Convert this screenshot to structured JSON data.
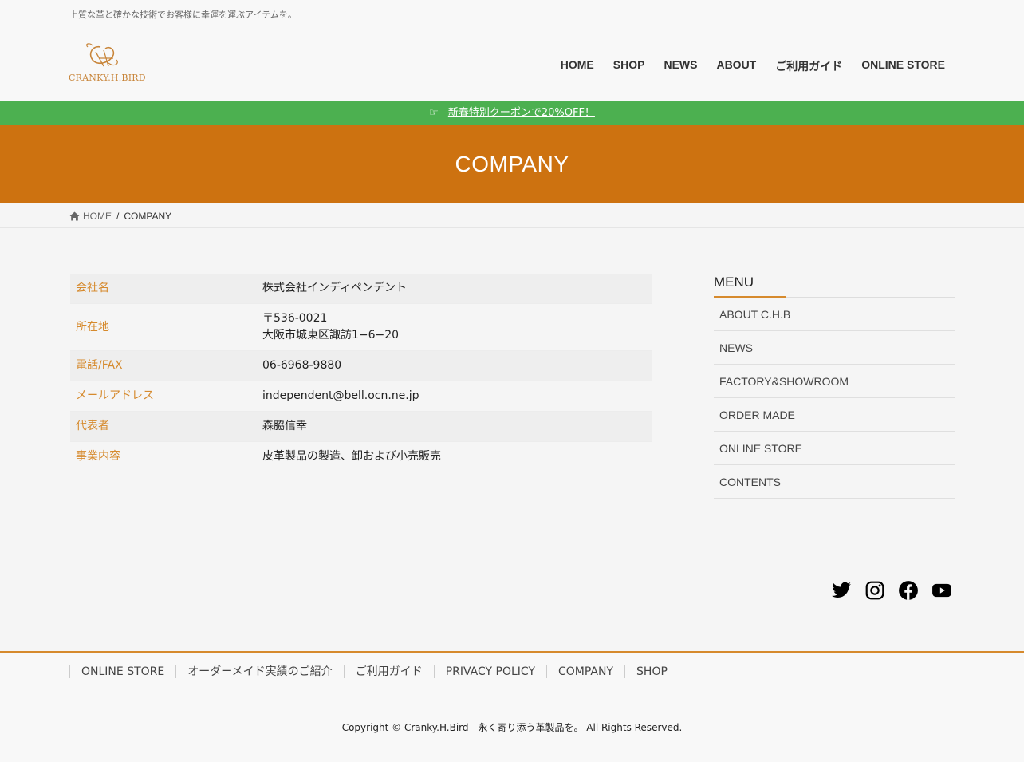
{
  "topbar": {
    "tagline": "上質な革と確かな技術でお客様に幸運を運ぶアイテムを。"
  },
  "header": {
    "logo_text": "CRANKY.H.BIRD",
    "nav": [
      "HOME",
      "SHOP",
      "NEWS",
      "ABOUT",
      "ご利用ガイド",
      "ONLINE STORE"
    ]
  },
  "promo": {
    "icon": "pointing-hand-icon",
    "link_text": "新春特別クーポンで20%OFF！",
    "color": "#4cb050"
  },
  "hero": {
    "title": "COMPANY",
    "color": "#cd7210"
  },
  "breadcrumb": {
    "home": "HOME",
    "separator": "/",
    "current": "COMPANY"
  },
  "company": {
    "rows": [
      {
        "label": "会社名",
        "value": "株式会社インディペンデント"
      },
      {
        "label": "所在地",
        "value": "〒536-0021",
        "value2": "大阪市城東区諏訪1−6−20"
      },
      {
        "label": "電話/FAX",
        "value": "06-6968-9880"
      },
      {
        "label": "メールアドレス",
        "value": "independent@bell.ocn.ne.jp"
      },
      {
        "label": "代表者",
        "value": "森脇信幸"
      },
      {
        "label": "事業内容",
        "value": "皮革製品の製造、卸および小売販売"
      }
    ]
  },
  "sidebar": {
    "title": "MENU",
    "items": [
      "ABOUT C.H.B",
      "NEWS",
      "FACTORY&SHOWROOM",
      "ORDER MADE",
      "ONLINE STORE",
      "CONTENTS"
    ]
  },
  "social": [
    "twitter-icon",
    "instagram-icon",
    "facebook-icon",
    "youtube-icon"
  ],
  "footer": {
    "nav": [
      "ONLINE STORE",
      "オーダーメイド実績のご紹介",
      "ご利用ガイド",
      "PRIVACY POLICY",
      "COMPANY",
      "SHOP"
    ],
    "copyright": "Copyright © Cranky.H.Bird - 永く寄り添う革製品を。 All Rights Reserved.",
    "accent": "#d68a2d"
  }
}
